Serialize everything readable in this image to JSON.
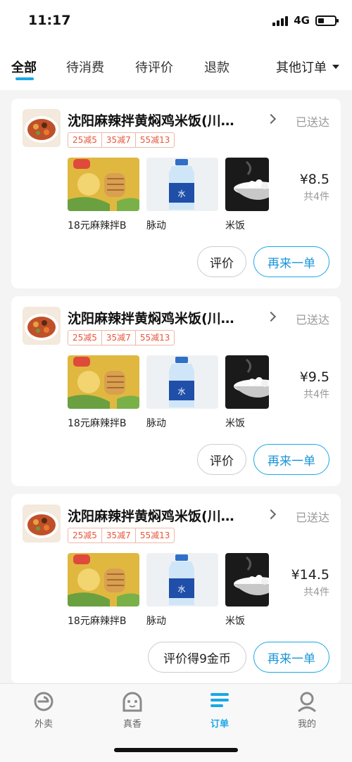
{
  "status_bar": {
    "time": "11:17",
    "network": "4G"
  },
  "tabs": [
    {
      "label": "全部"
    },
    {
      "label": "待消费"
    },
    {
      "label": "待评价"
    },
    {
      "label": "退款"
    }
  ],
  "tab_more": "其他订单",
  "orders": [
    {
      "shop_name": "沈阳麻辣拌黄焖鸡米饭(川…",
      "status": "已送达",
      "promos": [
        "25减5",
        "35减7",
        "55减13"
      ],
      "items": [
        "18元麻辣拌B",
        "脉动",
        "米饭"
      ],
      "price": "¥8.5",
      "count": "共4件",
      "review_label": "评价",
      "reorder_label": "再来一单"
    },
    {
      "shop_name": "沈阳麻辣拌黄焖鸡米饭(川…",
      "status": "已送达",
      "promos": [
        "25减5",
        "35减7",
        "55减13"
      ],
      "items": [
        "18元麻辣拌B",
        "脉动",
        "米饭"
      ],
      "price": "¥9.5",
      "count": "共4件",
      "review_label": "评价",
      "reorder_label": "再来一单"
    },
    {
      "shop_name": "沈阳麻辣拌黄焖鸡米饭(川…",
      "status": "已送达",
      "promos": [
        "25减5",
        "35减7",
        "55减13"
      ],
      "items": [
        "18元麻辣拌B",
        "脉动",
        "米饭"
      ],
      "price": "¥14.5",
      "count": "共4件",
      "review_label": "评价得9金币",
      "reorder_label": "再来一单"
    }
  ],
  "bottom_nav": [
    {
      "label": "外卖",
      "icon": "waimai-icon"
    },
    {
      "label": "真香",
      "icon": "zhenxiang-icon"
    },
    {
      "label": "订单",
      "icon": "orders-icon",
      "active": true
    },
    {
      "label": "我的",
      "icon": "profile-icon"
    }
  ],
  "colors": {
    "accent": "#1aa7e8",
    "promo": "#e8553c",
    "muted": "#999999"
  }
}
